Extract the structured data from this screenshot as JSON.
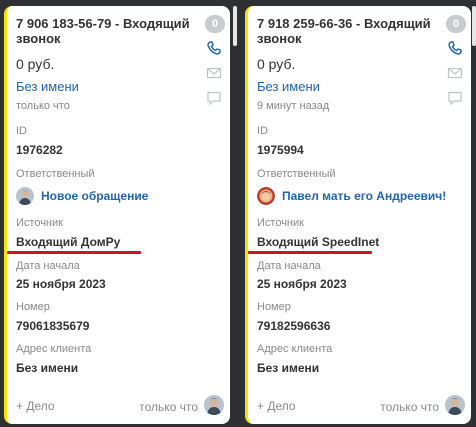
{
  "cards": [
    {
      "title": "7 906 183-56-79 - Входящий звонок",
      "badge": "0",
      "price": "0 руб.",
      "contact": "Без имени",
      "when": "только что",
      "id_label": "ID",
      "id_value": "1976282",
      "responsible_label": "Ответственный",
      "responsible_name": "Новое обращение",
      "source_label": "Источник",
      "source_value": "Входящий ДомРу",
      "date_label": "Дата начала",
      "date_value": "25 ноября 2023",
      "number_label": "Номер",
      "number_value": "79061835679",
      "address_label": "Адрес клиента",
      "address_value": "Без имени",
      "add_deal": "+ Дело",
      "footer_time": "только что"
    },
    {
      "title": "7 918 259-66-36 - Входящий звонок",
      "badge": "0",
      "price": "0 руб.",
      "contact": "Без имени",
      "when": "9 минут назад",
      "id_label": "ID",
      "id_value": "1975994",
      "responsible_label": "Ответственный",
      "responsible_name": "Павел мать его Андреевич!",
      "source_label": "Источник",
      "source_value": "Входящий SpeedInet",
      "date_label": "Дата начала",
      "date_value": "25 ноября 2023",
      "number_label": "Номер",
      "number_value": "79182596636",
      "address_label": "Адрес клиента",
      "address_value": "Без имени",
      "add_deal": "+ Дело",
      "footer_time": "только что"
    }
  ],
  "colors": {
    "accent_stripe": "#f6e500",
    "link": "#2067b0",
    "underline": "#d2141a",
    "background": "#2f3033"
  },
  "icons": [
    "phone-icon",
    "mail-icon",
    "chat-icon"
  ]
}
